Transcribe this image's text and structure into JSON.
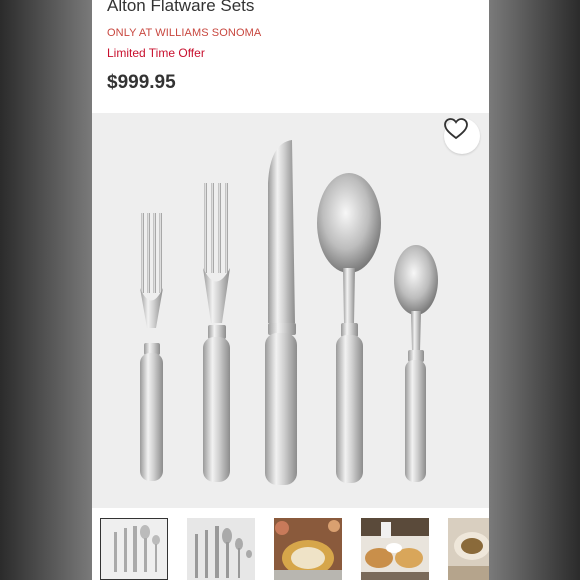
{
  "product": {
    "title": "Alton Flatware Sets",
    "exclusive_label": "ONLY AT WILLIAMS SONOMA",
    "offer_label": "Limited Time Offer",
    "price": "$999.95"
  },
  "gallery": {
    "hero_image": "flatware-five-piece-place-setting",
    "favorite_icon": "heart-outline-icon",
    "thumbnails": [
      {
        "name": "thumb-place-setting",
        "selected": true
      },
      {
        "name": "thumb-flatware-pieces",
        "selected": false
      },
      {
        "name": "thumb-table-setting-gold",
        "selected": false
      },
      {
        "name": "thumb-table-setting-dining",
        "selected": false
      },
      {
        "name": "thumb-table-setting-bowl",
        "selected": false
      }
    ]
  },
  "colors": {
    "accent": "#c8102e",
    "exclusive_text": "#c8473f",
    "price_text": "#333333"
  }
}
